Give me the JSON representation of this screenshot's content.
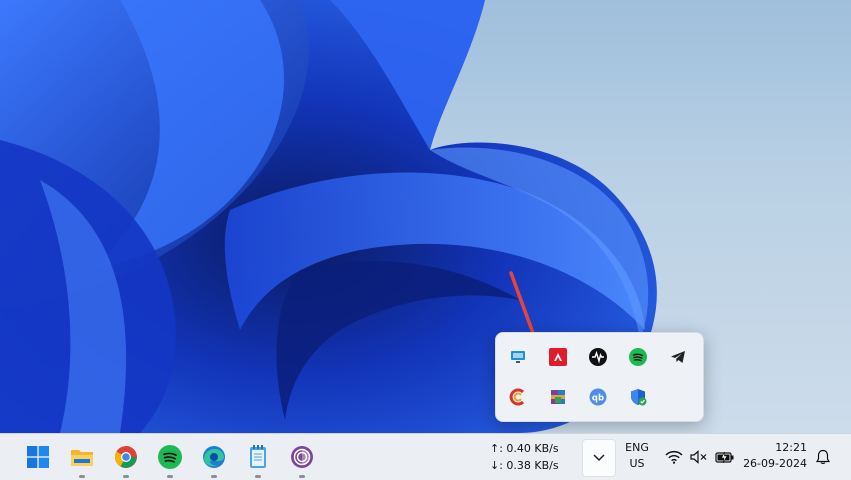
{
  "taskbar": {
    "apps": [
      {
        "icon": "windows-start-icon",
        "running": false
      },
      {
        "icon": "file-explorer-icon",
        "running": true
      },
      {
        "icon": "chrome-icon",
        "running": true
      },
      {
        "icon": "spotify-icon",
        "running": true
      },
      {
        "icon": "edge-icon",
        "running": true
      },
      {
        "icon": "notepad-icon",
        "running": true
      },
      {
        "icon": "tor-browser-icon",
        "running": true
      }
    ],
    "net_speed": {
      "upload": "↑: 0.40 KB/s",
      "download": "↓: 0.38 KB/s"
    },
    "language": {
      "line1": "ENG",
      "line2": "US"
    },
    "clock": {
      "time": "12:21",
      "date": "26-09-2024"
    }
  },
  "tray_flyout": {
    "icons": [
      "monitor-icon",
      "amd-icon",
      "audio-wave-icon",
      "spotify-icon",
      "telegram-icon",
      "ccleaner-icon",
      "winrar-icon",
      "qbittorrent-icon",
      "windows-security-icon"
    ]
  },
  "annotation": {
    "arrow_color": "#e8443a"
  },
  "colors": {
    "wallpaper_blue": "#1a47d6",
    "taskbar_bg": "#ebeef3"
  }
}
